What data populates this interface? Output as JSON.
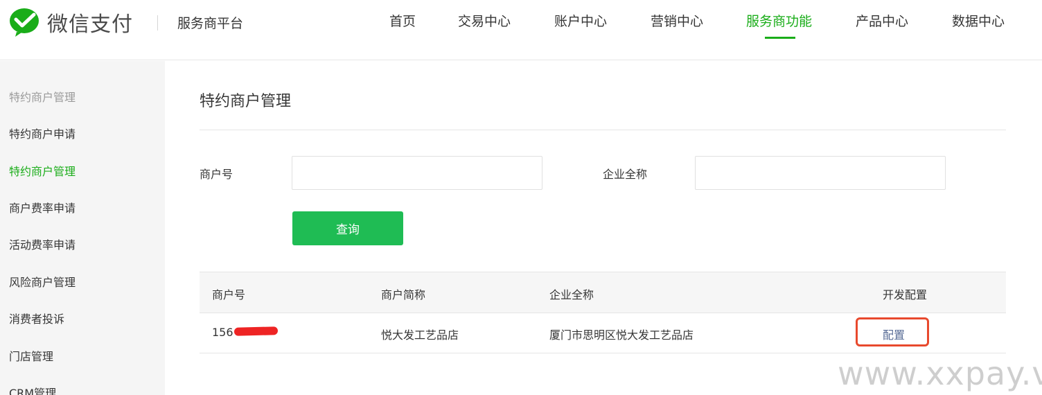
{
  "header": {
    "brand": "微信支付",
    "platform": "服务商平台",
    "nav": [
      {
        "label": "首页"
      },
      {
        "label": "交易中心"
      },
      {
        "label": "账户中心"
      },
      {
        "label": "营销中心"
      },
      {
        "label": "服务商功能",
        "active": true
      },
      {
        "label": "产品中心"
      },
      {
        "label": "数据中心"
      }
    ]
  },
  "sidebar": {
    "group_title": "特约商户管理",
    "items": [
      {
        "label": "特约商户申请"
      },
      {
        "label": "特约商户管理",
        "active": true
      },
      {
        "label": "商户费率申请"
      },
      {
        "label": "活动费率申请"
      },
      {
        "label": "风险商户管理"
      },
      {
        "label": "消费者投诉"
      },
      {
        "label": "门店管理"
      },
      {
        "label": "CRM管理"
      }
    ]
  },
  "main": {
    "title": "特约商户管理",
    "form": {
      "merchant_id_label": "商户号",
      "merchant_id_value": "",
      "company_label": "企业全称",
      "company_value": "",
      "query_button": "查询"
    },
    "table": {
      "headers": [
        "商户号",
        "商户简称",
        "企业全称",
        "开发配置"
      ],
      "rows": [
        {
          "merchant_id": "156",
          "short_name": "悦大发工艺品店",
          "full_name": "厦门市思明区悦大发工艺品店",
          "action": "配置"
        }
      ]
    }
  },
  "watermark": "www.xxpay.vip",
  "colors": {
    "brand_green": "#1aad19",
    "button_green": "#1fbc54",
    "link_blue": "#576b95",
    "highlight_red": "#e8492d"
  }
}
